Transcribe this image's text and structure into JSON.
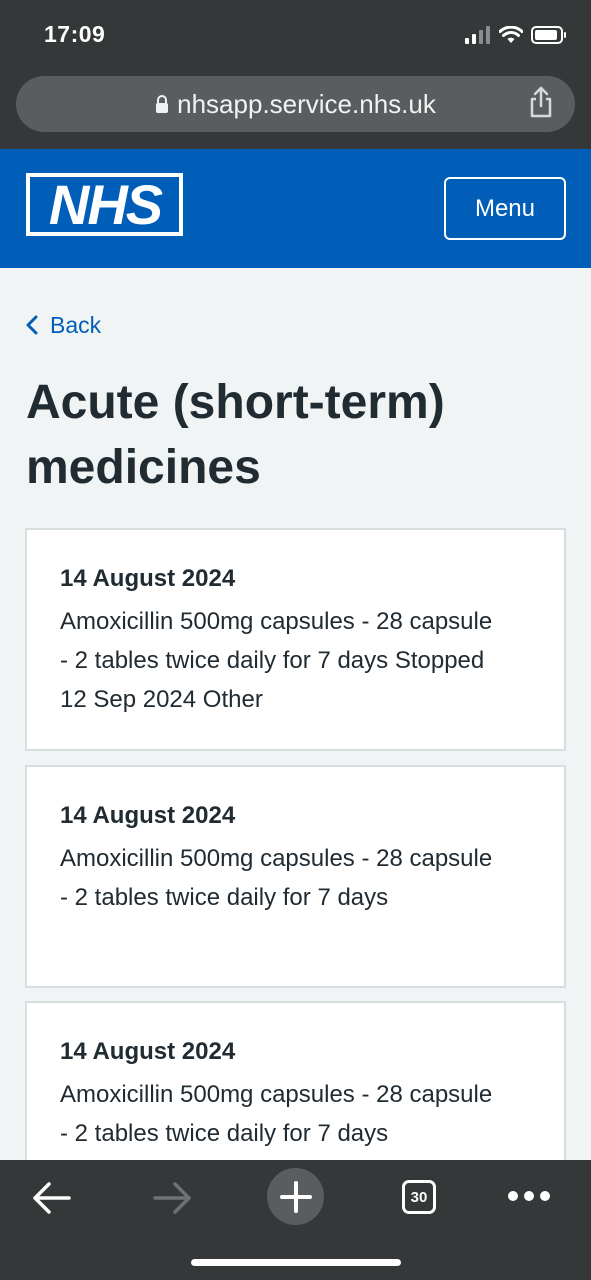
{
  "status_bar": {
    "time": "17:09"
  },
  "browser": {
    "url": "nhsapp.service.nhs.uk",
    "tab_count": "30"
  },
  "header": {
    "logo_text": "NHS",
    "menu_label": "Menu"
  },
  "nav": {
    "back_label": "Back"
  },
  "page": {
    "title": "Acute (short-term) medicines"
  },
  "medicines": [
    {
      "date": "14 August 2024",
      "description": "Amoxicillin 500mg capsules - 28 capsule - 2 tables twice daily for 7 days Stopped 12 Sep 2024 Other"
    },
    {
      "date": "14 August 2024",
      "description": "Amoxicillin 500mg capsules - 28 capsule - 2 tables twice daily for 7 days"
    },
    {
      "date": "14 August 2024",
      "description": "Amoxicillin 500mg capsules - 28 capsule - 2 tables twice daily for 7 days"
    }
  ],
  "colors": {
    "nhs_blue": "#005eb8",
    "background": "#f0f4f5",
    "text": "#212b32",
    "browser_chrome": "#353839"
  }
}
